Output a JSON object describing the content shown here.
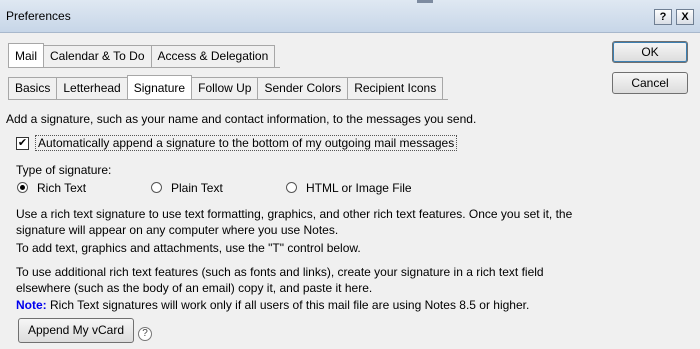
{
  "window": {
    "title": "Preferences",
    "help_symbol": "?",
    "close_symbol": "X"
  },
  "top_tabs": [
    "Mail",
    "Calendar & To Do",
    "Access & Delegation"
  ],
  "sub_tabs": [
    "Basics",
    "Letterhead",
    "Signature",
    "Follow Up",
    "Sender Colors",
    "Recipient Icons"
  ],
  "active_top_tab": "Mail",
  "active_sub_tab": "Signature",
  "buttons": {
    "ok": "OK",
    "cancel": "Cancel",
    "vcard": "Append My vCard"
  },
  "content": {
    "intro": "Add a signature, such as your name and contact information, to the messages you send.",
    "auto_append": {
      "label": "Automatically append a signature to the bottom of my outgoing mail messages",
      "checked": true,
      "check_glyph": "✔"
    },
    "type_label": "Type of signature:",
    "types": [
      {
        "label": "Rich Text",
        "selected": true
      },
      {
        "label": "Plain Text",
        "selected": false
      },
      {
        "label": "HTML or Image File",
        "selected": false
      }
    ],
    "desc1_line1": "Use a rich text signature to use text formatting, graphics, and other rich text features.   Once you set it, the",
    "desc1_line2": "signature will appear on any computer where you use Notes.",
    "desc2": "To add text, graphics and attachments, use the \"T\" control below.",
    "desc3_line1": "To use additional rich text features (such as fonts and links), create your signature in a rich text field",
    "desc3_line2": "elsewhere (such as the body of an email) copy it, and paste it here.",
    "note_label": "Note:",
    "note_text": "  Rich Text signatures will work only if all users of this mail file are using Notes 8.5 or higher.",
    "help_symbol": "?"
  }
}
